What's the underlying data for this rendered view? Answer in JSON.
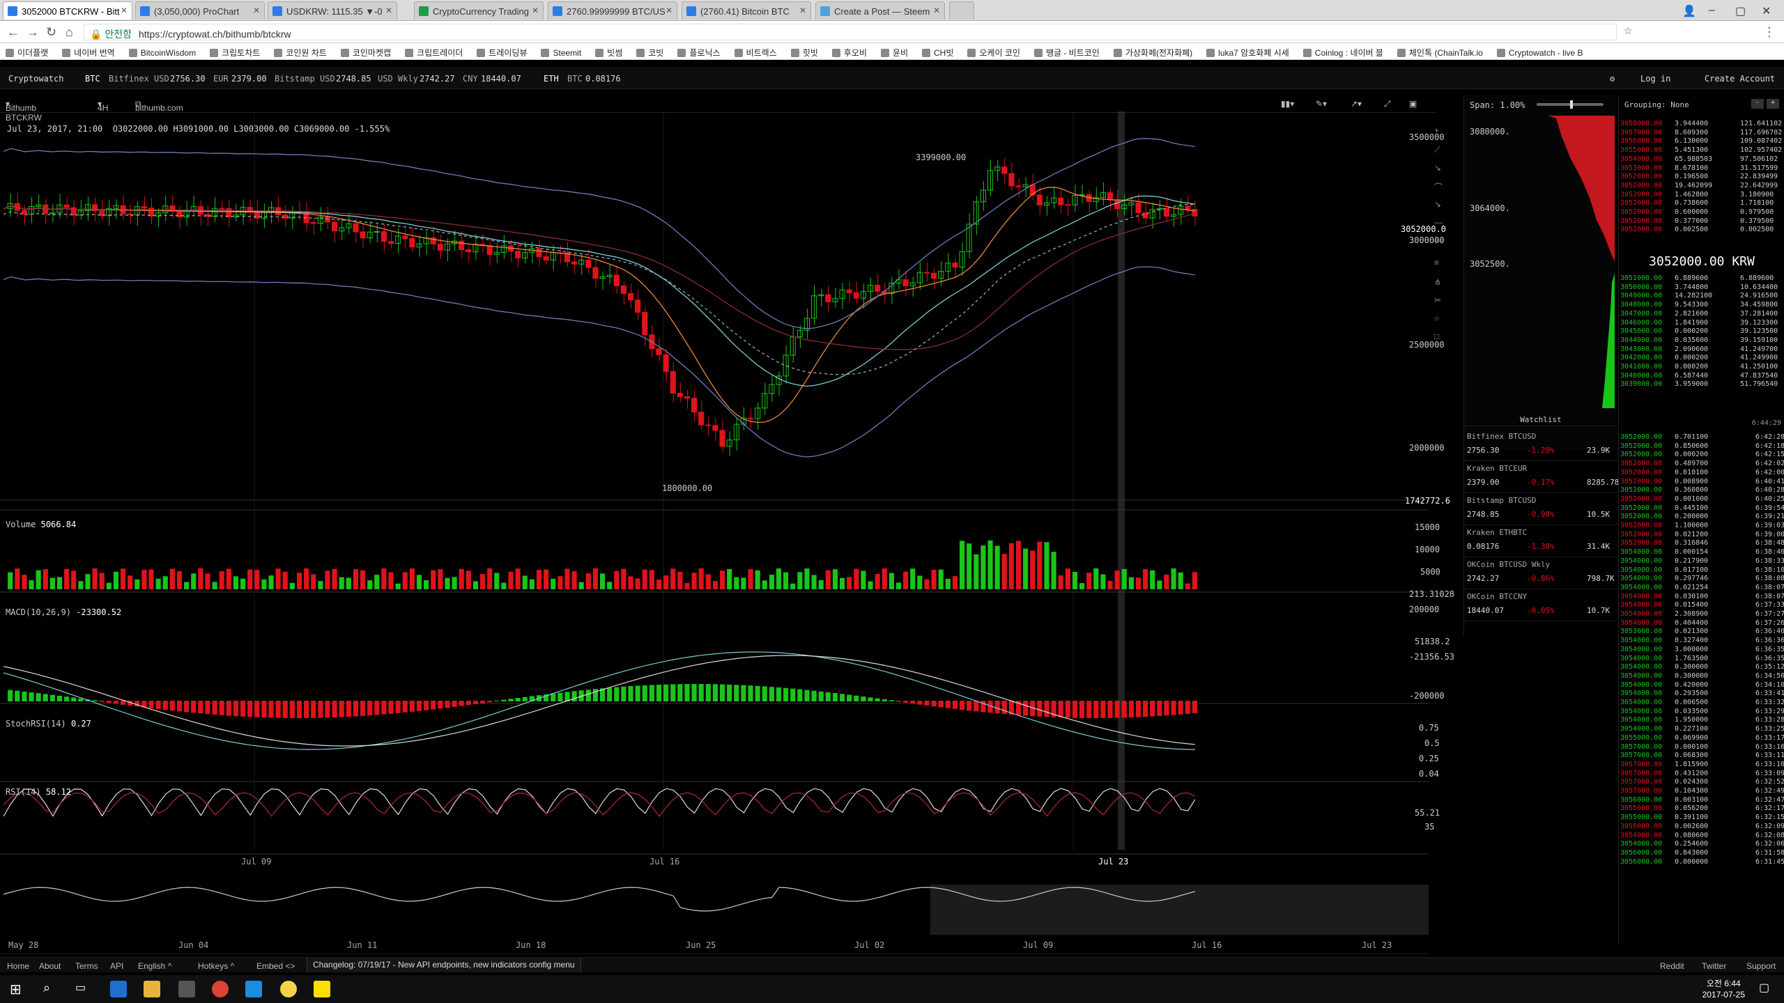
{
  "browser": {
    "tabs": [
      "3052000 BTCKRW - Bitt",
      "(3,050,000) ProChart",
      "USDKRW: 1115.35 ▼-0",
      "CryptoCurrency Trading",
      "2760.99999999 BTC/US",
      "(2760.41) Bitcoin BTC",
      "Create a Post — Steem"
    ],
    "secure_label": "안전함",
    "url": "https://cryptowat.ch/bithumb/btckrw"
  },
  "bookmarks": [
    "이더플랫",
    "네이버 번역",
    "BitcoinWisdom",
    "크립토차트",
    "코인원 차트",
    "코인마켓캡",
    "크립트레이더",
    "트레이딩뷰",
    "Steemit",
    "빗썸",
    "코빗",
    "플로닉스",
    "비트렉스",
    "힛빗",
    "후오비",
    "윤비",
    "CH빗",
    "오케이 코인",
    "땡글 - 비트코인",
    "가상화페(전자화폐)",
    "luka7 암호화폐 시세",
    "Coinlog : 네이버 블",
    "체인톡 (ChainTalk.io",
    "Cryptowatch - live B"
  ],
  "header": {
    "brand": "Cryptowatch",
    "btc": "BTC",
    "bitfinex_label": "Bitfinex USD",
    "bitfinex_value": "2756.30",
    "eur_label": "EUR",
    "eur_value": "2379.00",
    "bitstamp_label": "Bitstamp USD",
    "bitstamp_value": "2748.85",
    "wkly_label": "USD Wkly",
    "wkly_value": "2742.27",
    "cny_label": "CNY",
    "cny_value": "18440.07",
    "eth": "ETH",
    "ethbtc_label": "BTC",
    "ethbtc_value": "0.08176",
    "login": "Log in",
    "create": "Create Account"
  },
  "toolbar": {
    "market": "Bithumb BTCKRW",
    "period": "4H",
    "site": "bithumb.com"
  },
  "ohlc": {
    "date": "Jul 23, 2017, 21:00",
    "o": "O3022000.00",
    "h": "H3091000.00",
    "l": "L3003000.00",
    "c": "C3069000.00",
    "chg": "-1.555%"
  },
  "main_axis": [
    "3500000",
    "3052000.0",
    "3000000",
    "2500000",
    "2000000",
    "1742772.6"
  ],
  "main_annotations": {
    "high": "3399000.00",
    "low": "1800000.00"
  },
  "volume": {
    "label": "Volume",
    "value": "5066.84",
    "axis": [
      "15000",
      "10000",
      "5000",
      "213.31028"
    ]
  },
  "macd": {
    "label": "MACD(10,26,9)",
    "value": "-23300.52",
    "axis": [
      "200000",
      "51838.2",
      "-21356.53",
      "-200000"
    ]
  },
  "stochrsi": {
    "label": "StochRSI(14)",
    "value": "0.27",
    "axis": [
      "0.75",
      "0.5",
      "0.25",
      "0.04"
    ]
  },
  "rsi": {
    "label": "RSI(14)",
    "value": "58.12",
    "axis": [
      "55.21",
      "35"
    ]
  },
  "xaxis": [
    "Jul 09",
    "Jul 16",
    "Jul 23"
  ],
  "overview_xaxis": [
    "May 28",
    "Jun 04",
    "Jun 11",
    "Jun 18",
    "Jun 25",
    "Jul 02",
    "Jul 09",
    "Jul 16",
    "Jul 23"
  ],
  "span": {
    "label": "Span:",
    "value": "1.00%",
    "axis": [
      "3080000.",
      "3064000.",
      "3052500."
    ]
  },
  "grouping": {
    "label": "Grouping:",
    "value": "None"
  },
  "big_price": "3052000.00 KRW",
  "asks": [
    [
      "3058000.00",
      "3.944400",
      "121.641102"
    ],
    [
      "3057000.00",
      "8.609300",
      "117.696702"
    ],
    [
      "3056000.00",
      "6.130000",
      "109.087402"
    ],
    [
      "3055000.00",
      "5.451300",
      "102.957402"
    ],
    [
      "3054000.00",
      "65.988503",
      "97.506102"
    ],
    [
      "3053000.00",
      "8.678100",
      "31.517599"
    ],
    [
      "3052000.00",
      "0.196500",
      "22.839499"
    ],
    [
      "3052000.00",
      "19.462099",
      "22.642999"
    ],
    [
      "3052000.00",
      "1.462800",
      "3.180900"
    ],
    [
      "3052000.00",
      "0.738600",
      "1.718100"
    ],
    [
      "3052000.00",
      "0.600000",
      "0.979500"
    ],
    [
      "3052000.00",
      "0.377000",
      "0.379500"
    ],
    [
      "3052000.00",
      "0.002500",
      "0.002500"
    ]
  ],
  "bids": [
    [
      "3051000.00",
      "6.889600",
      "6.889600"
    ],
    [
      "3050000.00",
      "3.744800",
      "10.634400"
    ],
    [
      "3049000.00",
      "14.282100",
      "24.916500"
    ],
    [
      "3048000.00",
      "9.543300",
      "34.459800"
    ],
    [
      "3047000.00",
      "2.821600",
      "37.281400"
    ],
    [
      "3046000.00",
      "1.841900",
      "39.123300"
    ],
    [
      "3045000.00",
      "0.000200",
      "39.123500"
    ],
    [
      "3044000.00",
      "0.035600",
      "39.159100"
    ],
    [
      "3043000.00",
      "2.090600",
      "41.249700"
    ],
    [
      "3042000.00",
      "0.000200",
      "41.249900"
    ],
    [
      "3041000.00",
      "0.000200",
      "41.250100"
    ],
    [
      "3040000.00",
      "6.587440",
      "47.837540"
    ],
    [
      "3039000.00",
      "3.959000",
      "51.796540"
    ]
  ],
  "trades_time_header": "6:44:29",
  "trades": [
    [
      "3052000.00",
      "0.701100",
      "6:42:28",
      "g"
    ],
    [
      "3052000.00",
      "0.850600",
      "6:42:18",
      "g"
    ],
    [
      "3052000.00",
      "0.000200",
      "6:42:15",
      "g"
    ],
    [
      "3052000.00",
      "0.489700",
      "6:42:02",
      "r"
    ],
    [
      "3052000.00",
      "0.010100",
      "6:42:00",
      "r"
    ],
    [
      "3052000.00",
      "0.008900",
      "6:40:41",
      "r"
    ],
    [
      "3052000.00",
      "0.360800",
      "6:40:28",
      "g"
    ],
    [
      "3052000.00",
      "0.001000",
      "6:40:25",
      "r"
    ],
    [
      "3052000.00",
      "0.445100",
      "6:39:54",
      "g"
    ],
    [
      "3052000.00",
      "0.200000",
      "6:39:21",
      "g"
    ],
    [
      "3052000.00",
      "1.100000",
      "6:39:03",
      "r"
    ],
    [
      "3052000.00",
      "0.021200",
      "6:39:00",
      "r"
    ],
    [
      "3052000.00",
      "0.316846",
      "6:38:48",
      "r"
    ],
    [
      "3054000.00",
      "0.000154",
      "6:38:40",
      "g"
    ],
    [
      "3054000.00",
      "0.217900",
      "6:38:33",
      "g"
    ],
    [
      "3054000.00",
      "0.017100",
      "6:38:10",
      "g"
    ],
    [
      "3054000.00",
      "0.297746",
      "6:38:08",
      "g"
    ],
    [
      "3054000.00",
      "0.021254",
      "6:38:07",
      "g"
    ],
    [
      "3054000.00",
      "0.030100",
      "6:38:07",
      "r"
    ],
    [
      "3054000.00",
      "0.015400",
      "6:37:33",
      "r"
    ],
    [
      "3054000.00",
      "2.308900",
      "6:37:27",
      "r"
    ],
    [
      "3054000.00",
      "0.404400",
      "6:37:26",
      "r"
    ],
    [
      "3053000.00",
      "0.021300",
      "6:36:40",
      "g"
    ],
    [
      "3054000.00",
      "0.327400",
      "6:36:36",
      "g"
    ],
    [
      "3054000.00",
      "3.000000",
      "6:36:35",
      "g"
    ],
    [
      "3054000.00",
      "1.763500",
      "6:36:35",
      "g"
    ],
    [
      "3054000.00",
      "0.300000",
      "6:35:12",
      "g"
    ],
    [
      "3054000.00",
      "0.300000",
      "6:34:50",
      "g"
    ],
    [
      "3054000.00",
      "0.420000",
      "6:34:10",
      "g"
    ],
    [
      "3054000.00",
      "0.293500",
      "6:33:41",
      "g"
    ],
    [
      "3054000.00",
      "0.006500",
      "6:33:32",
      "g"
    ],
    [
      "3054000.00",
      "0.033500",
      "6:33:29",
      "g"
    ],
    [
      "3054000.00",
      "1.950000",
      "6:33:28",
      "g"
    ],
    [
      "3054000.00",
      "0.227100",
      "6:33:25",
      "g"
    ],
    [
      "3055000.00",
      "0.069900",
      "6:33:17",
      "g"
    ],
    [
      "3057000.00",
      "0.000100",
      "6:33:16",
      "g"
    ],
    [
      "3057000.00",
      "0.068300",
      "6:33:11",
      "g"
    ],
    [
      "3057000.00",
      "1.815900",
      "6:33:10",
      "r"
    ],
    [
      "3057000.00",
      "0.431200",
      "6:33:09",
      "r"
    ],
    [
      "3057000.00",
      "0.024300",
      "6:32:52",
      "r"
    ],
    [
      "3057000.00",
      "0.104300",
      "6:32:49",
      "r"
    ],
    [
      "3056000.00",
      "0.003100",
      "6:32:47",
      "g"
    ],
    [
      "3055000.00",
      "0.056200",
      "6:32:17",
      "r"
    ],
    [
      "3055000.00",
      "0.391100",
      "6:32:15",
      "g"
    ],
    [
      "3055000.00",
      "0.002600",
      "6:32:09",
      "r"
    ],
    [
      "3054000.00",
      "0.080600",
      "6:32:08",
      "r"
    ],
    [
      "3054000.00",
      "0.254600",
      "6:32:06",
      "g"
    ],
    [
      "3056000.00",
      "0.843000",
      "6:31:58",
      "g"
    ],
    [
      "3056000.00",
      "0.000000",
      "6:31:45",
      "g"
    ]
  ],
  "watchlist": {
    "title": "Watchlist",
    "items": [
      {
        "name": "Bitfinex BTCUSD",
        "price": "2756.30",
        "chg": "-1.20%",
        "vol": "23.9K"
      },
      {
        "name": "Kraken BTCEUR",
        "price": "2379.00",
        "chg": "-0.17%",
        "vol": "8285.78"
      },
      {
        "name": "Bitstamp BTCUSD",
        "price": "2748.85",
        "chg": "-0.98%",
        "vol": "10.5K"
      },
      {
        "name": "Kraken ETHBTC",
        "price": "0.08176",
        "chg": "-1.38%",
        "vol": "31.4K"
      },
      {
        "name": "OKCoin BTCUSD Wkly",
        "price": "2742.27",
        "chg": "-0.86%",
        "vol": "798.7K"
      },
      {
        "name": "OKCoin BTCCNY",
        "price": "18440.07",
        "chg": "-0.05%",
        "vol": "10.7K"
      }
    ]
  },
  "footer": {
    "home": "Home",
    "about": "About",
    "terms": "Terms",
    "api": "API",
    "lang": "English ^",
    "hotkeys": "Hotkeys ^",
    "embed": "Embed <>",
    "changelog": "Changelog: 07/19/17 - New API endpoints, new indicators config menu",
    "reddit": "Reddit",
    "twitter": "Twitter",
    "support": "Support"
  },
  "clock": {
    "time": "오전 6:44",
    "date": "2017-07-25"
  },
  "colors": {
    "up": "#19c519",
    "down": "#e0131b",
    "bg": "#000000",
    "panel": "#0e0e0e",
    "ma_orange": "#e8893c",
    "ma_blue": "#7ecbd6",
    "bb": "#8b9bd6"
  }
}
